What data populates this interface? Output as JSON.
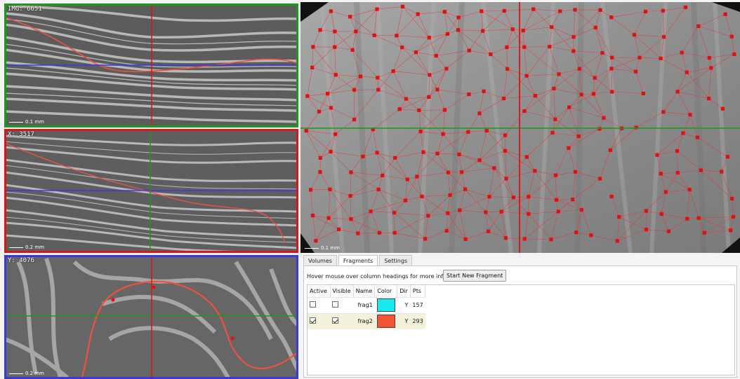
{
  "views": {
    "top": {
      "label": "IMG: 6651",
      "scale": "0.1 mm",
      "border_color": "#1a9a1a"
    },
    "middle": {
      "label": "X: 3517",
      "scale": "0.2 mm",
      "border_color": "#d31a1a"
    },
    "bottom": {
      "label": "Y: 4076",
      "scale": "0.2 mm",
      "border_color": "#3a3ad8"
    },
    "main": {
      "scale": "0.1 mm"
    }
  },
  "colors": {
    "crosshair_red": "#e01010",
    "crosshair_green": "#1a9a1a",
    "crosshair_blue": "#3a3ad8",
    "point_red": "#e01010",
    "fragment_line": "#f05040"
  },
  "panel": {
    "tabs": [
      {
        "label": "Volumes",
        "active": false
      },
      {
        "label": "Fragments",
        "active": true
      },
      {
        "label": "Settings",
        "active": false
      }
    ],
    "hint": "Hover mouse over column headings for more information",
    "new_fragment_button": "Start New Fragment",
    "table": {
      "headers": [
        "Active",
        "Visible",
        "Name",
        "Color",
        "Dir",
        "Pts"
      ],
      "rows": [
        {
          "active": false,
          "visible": false,
          "name": "frag1",
          "color": "#18e8f0",
          "dir": "Y",
          "pts": "157",
          "selected": false
        },
        {
          "active": true,
          "visible": true,
          "name": "frag2",
          "color": "#f25535",
          "dir": "Y",
          "pts": "293",
          "selected": true
        }
      ]
    }
  }
}
